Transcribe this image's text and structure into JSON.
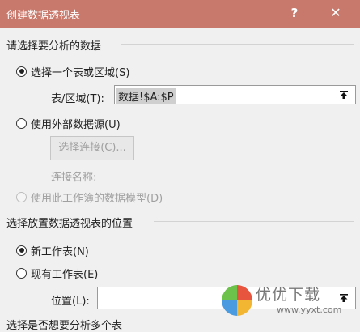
{
  "window": {
    "title": "创建数据透视表",
    "help_glyph": "?",
    "close_glyph": "✕"
  },
  "section1": {
    "header": "请选择要分析的数据",
    "option_table_range": "选择一个表或区域(S)",
    "range_label": "表/区域(T):",
    "range_value": "数据!$A:$P",
    "option_external": "使用外部数据源(U)",
    "choose_connection_button": "选择连接(C)...",
    "connection_name_label": "连接名称:",
    "option_data_model": "使用此工作簿的数据模型(D)"
  },
  "section2": {
    "header": "选择放置数据透视表的位置",
    "option_new_sheet": "新工作表(N)",
    "option_existing_sheet": "现有工作表(E)",
    "location_label": "位置(L):",
    "location_value": ""
  },
  "section3": {
    "header": "选择是否想要分析多个表"
  },
  "watermark": {
    "text": "优优下载",
    "url": "www.yyxt.com"
  }
}
